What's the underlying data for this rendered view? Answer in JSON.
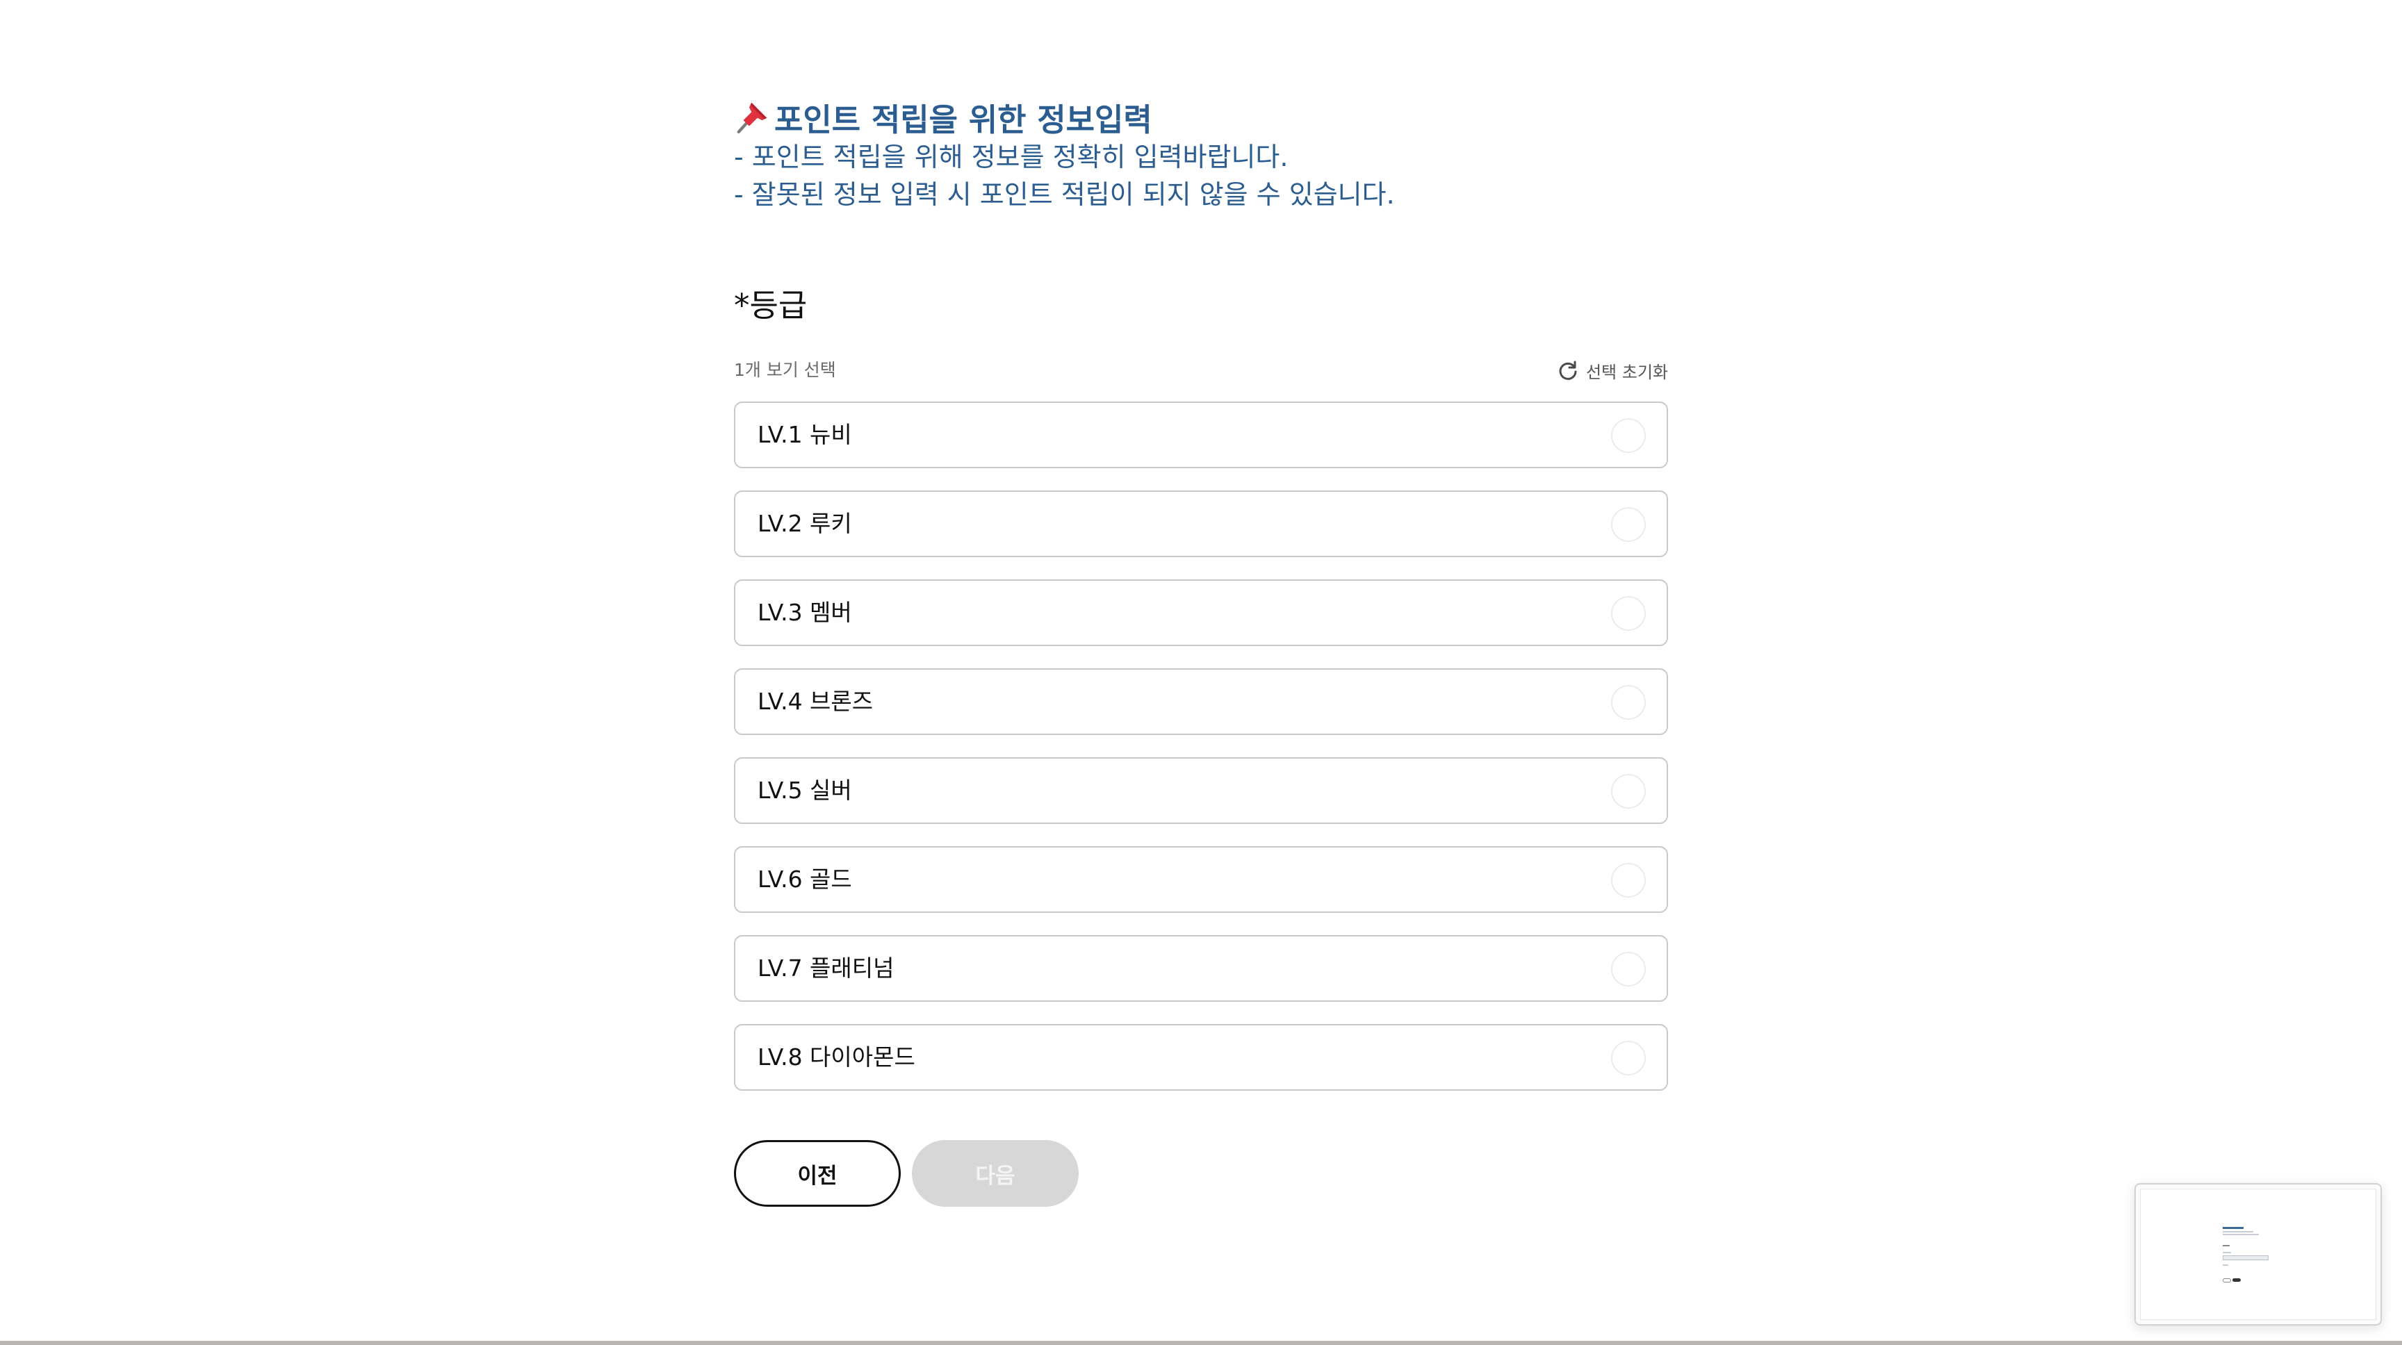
{
  "notice": {
    "pin_icon": "pushpin-icon",
    "title": "포인트 적립을 위한 정보입력",
    "line1": "- 포인트 적립을 위해 정보를 정확히 입력바랍니다.",
    "line2": "- 잘못된 정보 입력 시 포인트 적립이 되지 않을 수 있습니다."
  },
  "question": {
    "title": "*등급",
    "hint": "1개 보기 선택",
    "reset_icon": "refresh-icon",
    "reset_label": "선택 초기화",
    "options": [
      {
        "label": "LV.1 뉴비",
        "selected": false
      },
      {
        "label": "LV.2 루키",
        "selected": false
      },
      {
        "label": "LV.3 멤버",
        "selected": false
      },
      {
        "label": "LV.4 브론즈",
        "selected": false
      },
      {
        "label": "LV.5 실버",
        "selected": false
      },
      {
        "label": "LV.6 골드",
        "selected": false
      },
      {
        "label": "LV.7 플래티넘",
        "selected": false
      },
      {
        "label": "LV.8 다이아몬드",
        "selected": false
      }
    ]
  },
  "navigation": {
    "prev_label": "이전",
    "next_label": "다음",
    "next_enabled": false
  },
  "colors": {
    "notice_text": "#2b5d90",
    "option_border": "#c9c9c9",
    "disabled_button": "#d7d7d7"
  }
}
